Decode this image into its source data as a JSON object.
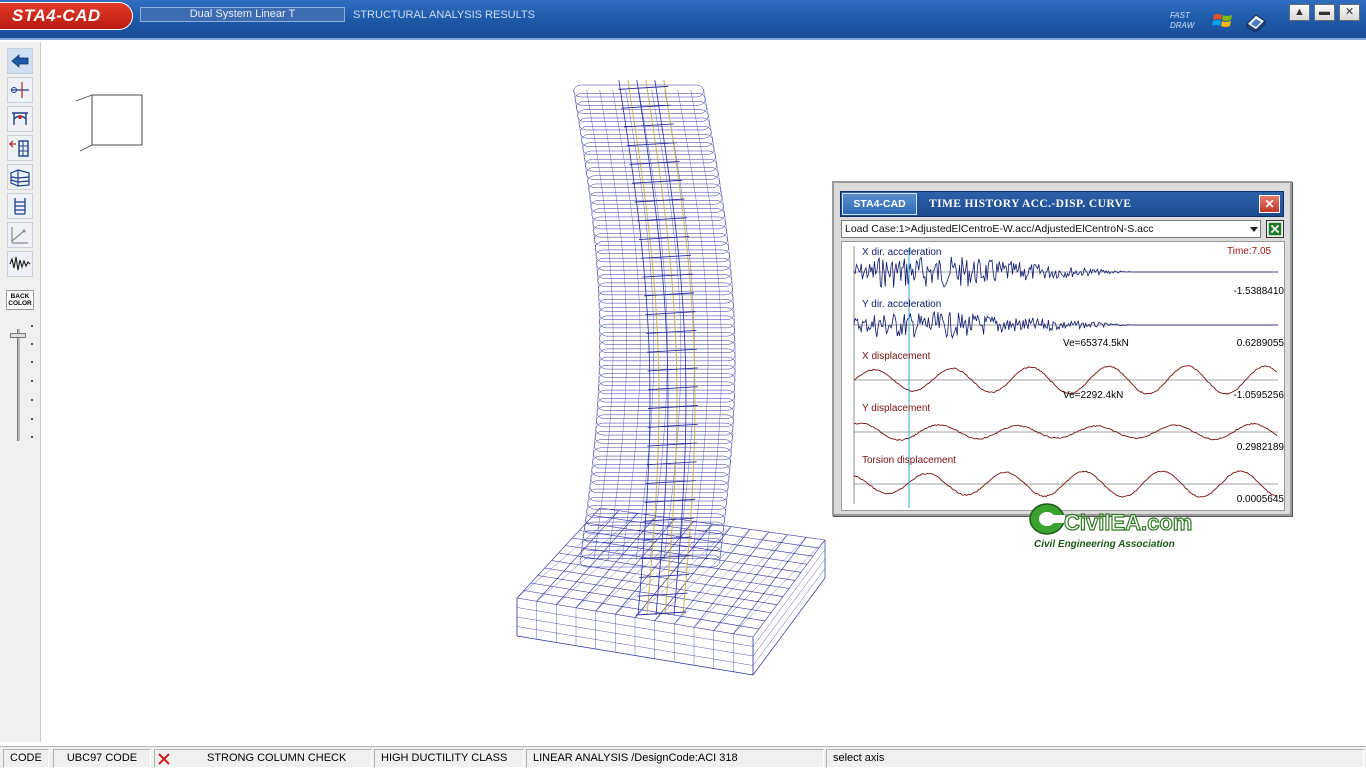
{
  "titlebar": {
    "app_logo": "STA4-CAD",
    "project_name": "Dual System Linear T",
    "mode_title": "STRUCTURAL ANALYSIS RESULTS",
    "fast_draw": "FAST\nDRAW",
    "fast_draw_line1": "FAST",
    "fast_draw_line2": "DRAW"
  },
  "toolbar": {
    "back_color_line1": "BACK",
    "back_color_line2": "COLOR"
  },
  "time_history_panel": {
    "brand": "STA4-CAD",
    "caption": "TIME HISTORY ACC.-DISP. CURVE",
    "load_case": "Load Case:1>AdjustedElCentroE-W.acc/AdjustedElCentroN-S.acc",
    "time_label": "Time:7.05",
    "traces": [
      {
        "label": "X dir. acceleration",
        "value": "-1.5388410"
      },
      {
        "label": "Y dir. acceleration",
        "value": "0.6289055"
      },
      {
        "label": "X displacement",
        "value": "-1.0595256"
      },
      {
        "label": "Y displacement",
        "value": "0.2982189"
      },
      {
        "label": "Torsion displacement",
        "value": "0.0005645"
      }
    ],
    "ve_x": "Ve=65374.5kN",
    "ve_y": "Ve=2292.4kN"
  },
  "watermark": {
    "domain": "CivilEA.com",
    "tagline": "Civil Engineering Association"
  },
  "statusbar": {
    "code": "CODE",
    "ubc": "UBC97 CODE",
    "strong_column": "STRONG COLUMN CHECK",
    "ductility": "HIGH DUCTILITY CLASS",
    "analysis": "LINEAR ANALYSIS /DesignCode:ACI 318",
    "prompt": "select axis"
  },
  "colors": {
    "titlebar": "#1d58a8",
    "logo_red": "#c92416",
    "acc_trace": "#101a6e",
    "disp_trace": "#7a1010",
    "time_cursor": "#2aa7d8",
    "wire_blue": "#2b2fa0",
    "wire_yellow": "#c9b24a"
  }
}
